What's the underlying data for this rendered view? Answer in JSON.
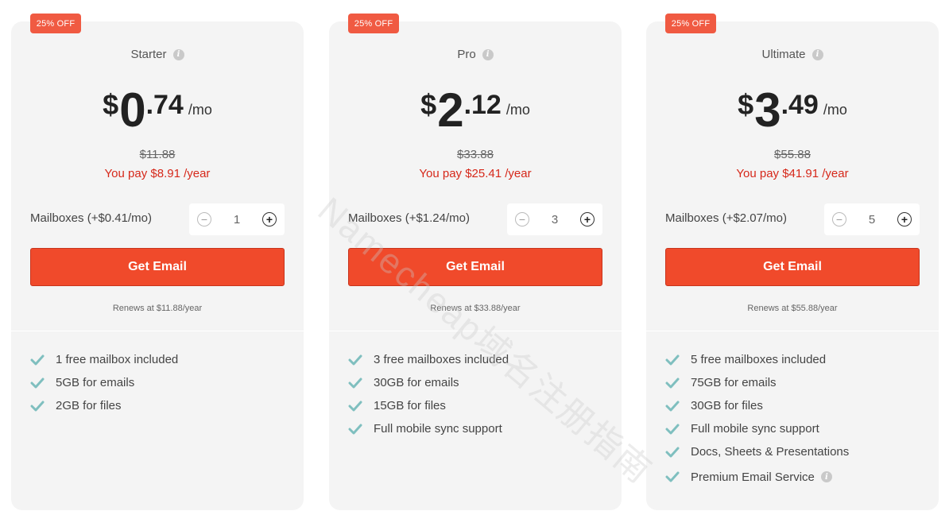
{
  "plans": [
    {
      "badge": "25% OFF",
      "name": "Starter",
      "currency": "$",
      "price_int": "0",
      "price_dec": ".74",
      "per": "/mo",
      "old_price": "$11.88",
      "you_pay": "You pay $8.91 /year",
      "mailbox_label": "Mailboxes (+$0.41/mo)",
      "mailbox_count": "1",
      "cta": "Get Email",
      "renews": "Renews at $11.88/year",
      "features": [
        "1 free mailbox included",
        "5GB for emails",
        "2GB for files"
      ]
    },
    {
      "badge": "25% OFF",
      "name": "Pro",
      "currency": "$",
      "price_int": "2",
      "price_dec": ".12",
      "per": "/mo",
      "old_price": "$33.88",
      "you_pay": "You pay $25.41 /year",
      "mailbox_label": "Mailboxes (+$1.24/mo)",
      "mailbox_count": "3",
      "cta": "Get Email",
      "renews": "Renews at $33.88/year",
      "features": [
        "3 free mailboxes included",
        "30GB for emails",
        "15GB for files",
        "Full mobile sync support"
      ]
    },
    {
      "badge": "25% OFF",
      "name": "Ultimate",
      "currency": "$",
      "price_int": "3",
      "price_dec": ".49",
      "per": "/mo",
      "old_price": "$55.88",
      "you_pay": "You pay $41.91 /year",
      "mailbox_label": "Mailboxes (+$2.07/mo)",
      "mailbox_count": "5",
      "cta": "Get Email",
      "renews": "Renews at $55.88/year",
      "features": [
        "5 free mailboxes included",
        "75GB for emails",
        "30GB for files",
        "Full mobile sync support",
        "Docs, Sheets & Presentations",
        "Premium Email Service"
      ]
    }
  ],
  "icons": {
    "info": "info-icon",
    "check": "check-icon",
    "minus": "minus-circle-icon",
    "plus": "plus-circle-icon"
  },
  "colors": {
    "accent": "#f04a2b",
    "badge": "#f05a42",
    "discount_text": "#d6281a",
    "check": "#7fbfbf",
    "card_bg": "#f4f4f4"
  },
  "watermark": "Namecheap域名注册指南"
}
